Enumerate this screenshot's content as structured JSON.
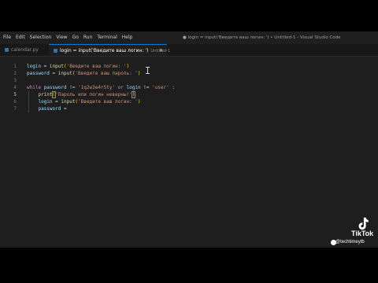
{
  "menubar": {
    "items": [
      "File",
      "Edit",
      "Selection",
      "View",
      "Go",
      "Run",
      "Terminal",
      "Help"
    ],
    "window_title": "● login = input('Введите ваш логин: ') • Untitled-1 - Visual Studio Code"
  },
  "tabs": [
    {
      "label": "calendar.py",
      "active": false
    },
    {
      "label": "login = input('Введите ваш логин: ')",
      "sublabel": "Untitled-1",
      "active": true
    }
  ],
  "editor": {
    "current_line": 5,
    "lines": [
      {
        "no": "1",
        "tokens": [
          [
            "var",
            "login"
          ],
          [
            "op",
            " = "
          ],
          [
            "fn",
            "input"
          ],
          [
            "br1",
            "("
          ],
          [
            "str",
            "'Введите ваш логин: '"
          ],
          [
            "br1",
            ")"
          ]
        ]
      },
      {
        "no": "2",
        "tokens": [
          [
            "var",
            "password"
          ],
          [
            "op",
            " = "
          ],
          [
            "fn",
            "input"
          ],
          [
            "br1",
            "("
          ],
          [
            "str",
            "'Введите ваш пароль: '"
          ],
          [
            "br1",
            ")"
          ]
        ]
      },
      {
        "no": "3",
        "tokens": []
      },
      {
        "no": "4",
        "tokens": [
          [
            "kw",
            "while"
          ],
          [
            "op",
            " "
          ],
          [
            "var",
            "password"
          ],
          [
            "op",
            " != "
          ],
          [
            "str",
            "'1q2w3e4r5ty'"
          ],
          [
            "op",
            " "
          ],
          [
            "kw",
            "or"
          ],
          [
            "op",
            " "
          ],
          [
            "var",
            "login"
          ],
          [
            "op",
            " != "
          ],
          [
            "str",
            "'user'"
          ],
          [
            "op",
            " :"
          ]
        ]
      },
      {
        "no": "5",
        "tokens": [
          [
            "op",
            "    "
          ],
          [
            "fn",
            "print"
          ],
          [
            "br1match",
            "("
          ],
          [
            "str",
            "'Пароль или логин неверны!'"
          ],
          [
            "br1match",
            ")"
          ]
        ]
      },
      {
        "no": "6",
        "tokens": [
          [
            "op",
            "    "
          ],
          [
            "var",
            "login"
          ],
          [
            "op",
            " = "
          ],
          [
            "fn",
            "input"
          ],
          [
            "br1",
            "("
          ],
          [
            "str",
            "'Введите ваш логин: '"
          ],
          [
            "br1",
            ")"
          ]
        ]
      },
      {
        "no": "7",
        "tokens": [
          [
            "op",
            "    "
          ],
          [
            "var",
            "password"
          ],
          [
            "op",
            " ="
          ]
        ]
      }
    ]
  },
  "watermark": {
    "brand": "TikTok",
    "handle": "@techtimeytb"
  },
  "colors": {
    "editor_bg": "#1e1e1e",
    "keyword": "#c586c0",
    "function": "#dcdcaa",
    "string": "#ce9178",
    "variable": "#9cdcfe",
    "bracket": "#ffd700",
    "accent": "#0078d4"
  }
}
